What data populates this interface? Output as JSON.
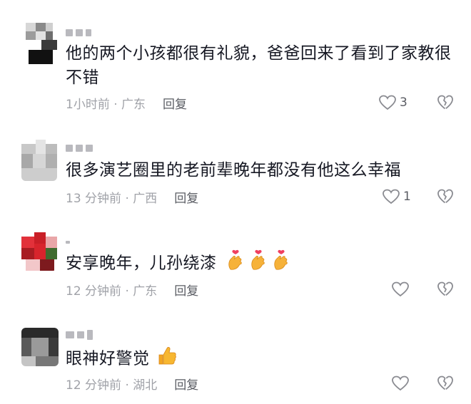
{
  "comments": [
    {
      "content": "他的两个小孩都很有礼貌，爸爸回来了看到了家教很不错",
      "content_line1": "他的两个小孩都很有礼貌，爸爸回来了看到了家教很",
      "content_line2": "不错",
      "time_location": "1小时前 · 广东",
      "reply_label": "回复",
      "like_count": "3",
      "avatar_color": "#3a3a3a"
    },
    {
      "content": "很多演艺圈里的老前辈晚年都没有他这么幸福",
      "time_location": "13 分钟前 · 广西",
      "reply_label": "回复",
      "like_count": "1",
      "avatar_color": "#b8b8b8"
    },
    {
      "content": "安享晚年，儿孙绕漆",
      "emoji": [
        "finger-heart",
        "finger-heart",
        "finger-heart"
      ],
      "time_location": "12 分钟前 · 广东",
      "reply_label": "回复",
      "like_count": "",
      "avatar_color": "#c0282a"
    },
    {
      "content": "眼神好警觉",
      "emoji": [
        "thumbs-up"
      ],
      "time_location": "12 分钟前 · 湖北",
      "reply_label": "回复",
      "like_count": "",
      "avatar_color": "#4a4a4a"
    }
  ],
  "icons": {
    "like": "heart-outline-icon",
    "dislike": "broken-heart-icon"
  },
  "colors": {
    "text_primary": "#161823",
    "text_meta": "#a0a2a8",
    "reply": "#5a5c63",
    "icon_gray": "#8a8b91"
  }
}
